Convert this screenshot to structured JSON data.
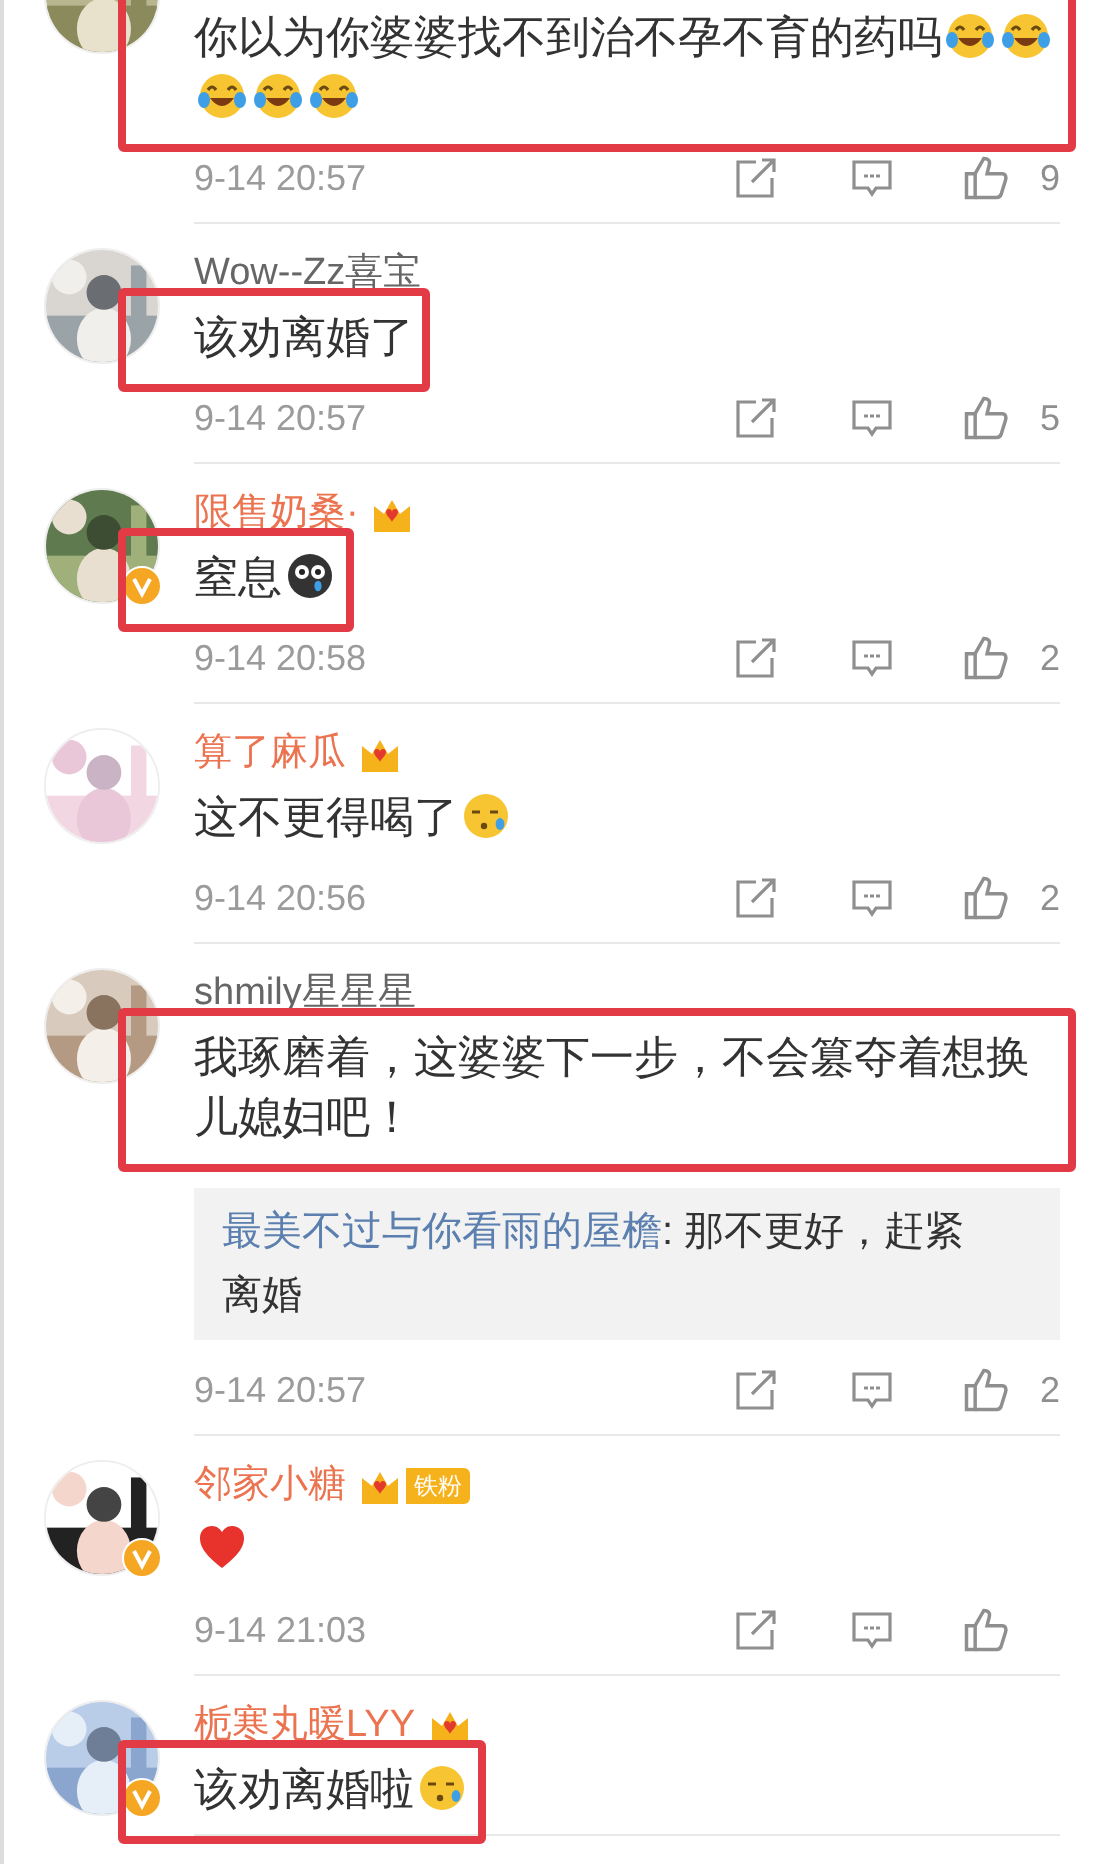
{
  "comments": [
    {
      "avatar": {
        "kind": "picture",
        "verified": false
      },
      "content": [
        {
          "kind": "text",
          "text": "你以为你婆婆找不到治不孕不育的药吗"
        },
        {
          "kind": "laugh_cry_emoji"
        },
        {
          "kind": "laugh_cry_emoji"
        },
        {
          "kind": "laugh_cry_emoji"
        },
        {
          "kind": "laugh_cry_emoji"
        },
        {
          "kind": "laugh_cry_emoji"
        }
      ],
      "highlighted": true,
      "time": "9-14 20:57",
      "likes": "9"
    },
    {
      "avatar": {
        "kind": "picture",
        "verified": false
      },
      "name": "Wow--Zz喜宝",
      "vip": false,
      "content": [
        {
          "kind": "text",
          "text": "该劝离婚了"
        }
      ],
      "highlighted": true,
      "time": "9-14 20:57",
      "likes": "5"
    },
    {
      "avatar": {
        "kind": "picture",
        "verified": true
      },
      "name": "限售奶桑·",
      "vip": true,
      "badges": [
        {
          "kind": "crown"
        }
      ],
      "content": [
        {
          "kind": "text",
          "text": "窒息"
        },
        {
          "kind": "dark_teary_emoji"
        }
      ],
      "highlighted": true,
      "time": "9-14 20:58",
      "likes": "2"
    },
    {
      "avatar": {
        "kind": "picture",
        "verified": false
      },
      "name": "算了麻瓜",
      "vip": true,
      "badges": [
        {
          "kind": "crown"
        }
      ],
      "content": [
        {
          "kind": "text",
          "text": "这不更得喝了"
        },
        {
          "kind": "sweat_emoji"
        }
      ],
      "highlighted": false,
      "time": "9-14 20:56",
      "likes": "2"
    },
    {
      "avatar": {
        "kind": "picture",
        "verified": false
      },
      "name": "shmily星星星",
      "vip": false,
      "content": [
        {
          "kind": "text",
          "text": "我琢磨着，这婆婆下一步，不会篡夺着想换儿媳妇吧！"
        }
      ],
      "highlighted": true,
      "reply": {
        "author": "最美不过与你看雨的屋檐",
        "text": ": 那不更好，赶紧离婚"
      },
      "time": "9-14 20:57",
      "likes": "2"
    },
    {
      "avatar": {
        "kind": "picture",
        "verified": true
      },
      "name": "邻家小糖",
      "vip": true,
      "badges": [
        {
          "kind": "crown"
        },
        {
          "kind": "fan",
          "label": "铁粉"
        }
      ],
      "content": [
        {
          "kind": "heart_emoji"
        }
      ],
      "highlighted": false,
      "time": "9-14 21:03"
    },
    {
      "avatar": {
        "kind": "picture",
        "verified": true
      },
      "name": "栀寒丸暖LYY",
      "vip": true,
      "badges": [
        {
          "kind": "crown"
        }
      ],
      "content": [
        {
          "kind": "text",
          "text": "该劝离婚啦"
        },
        {
          "kind": "sweat_emoji"
        }
      ],
      "highlighted": true
    }
  ]
}
